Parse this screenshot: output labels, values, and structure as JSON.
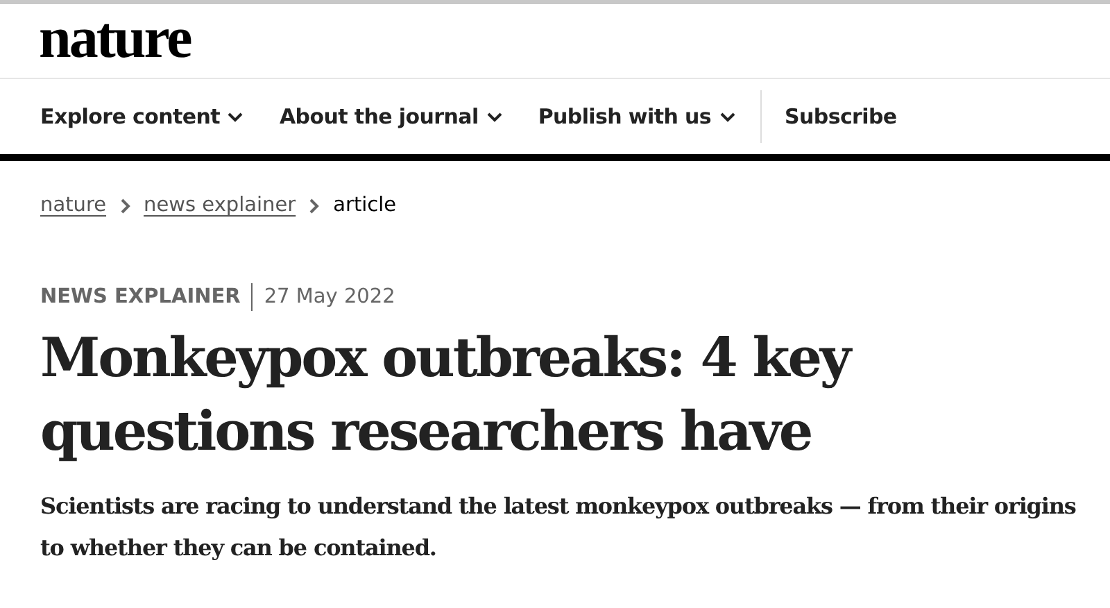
{
  "logo": "nature",
  "nav": [
    {
      "label": "Explore content",
      "dropdown": true
    },
    {
      "label": "About the journal",
      "dropdown": true
    },
    {
      "label": "Publish with us",
      "dropdown": true
    },
    {
      "label": "Subscribe",
      "dropdown": false
    }
  ],
  "breadcrumbs": [
    {
      "label": "nature",
      "link": true
    },
    {
      "label": "news explainer",
      "link": true
    },
    {
      "label": "article",
      "link": false
    }
  ],
  "article": {
    "type": "NEWS EXPLAINER",
    "date": "27 May 2022",
    "title": "Monkeypox outbreaks: 4 key questions researchers have",
    "standfirst": "Scientists are racing to understand the latest monkeypox outbreaks — from their origins to whether they can be contained."
  }
}
